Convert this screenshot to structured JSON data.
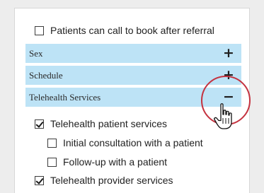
{
  "top_option": {
    "label": "Patients can call to book after referral",
    "checked": false
  },
  "sections": [
    {
      "title": "Sex",
      "toggle": "+"
    },
    {
      "title": "Schedule",
      "toggle": "+"
    },
    {
      "title": "Telehealth Services",
      "toggle": "−"
    }
  ],
  "telehealth": {
    "patient_services": {
      "label": "Telehealth patient services",
      "checked": true
    },
    "initial_consultation": {
      "label": "Initial consultation with a patient",
      "checked": false
    },
    "follow_up": {
      "label": "Follow-up with a patient",
      "checked": false
    },
    "provider_services": {
      "label": "Telehealth provider services",
      "checked": true
    }
  },
  "colors": {
    "section_background": "#bde3f6",
    "highlight_ring": "#c4323f",
    "page_background": "#ededed"
  },
  "cursor": {
    "icon": "hand-pointer-icon"
  }
}
